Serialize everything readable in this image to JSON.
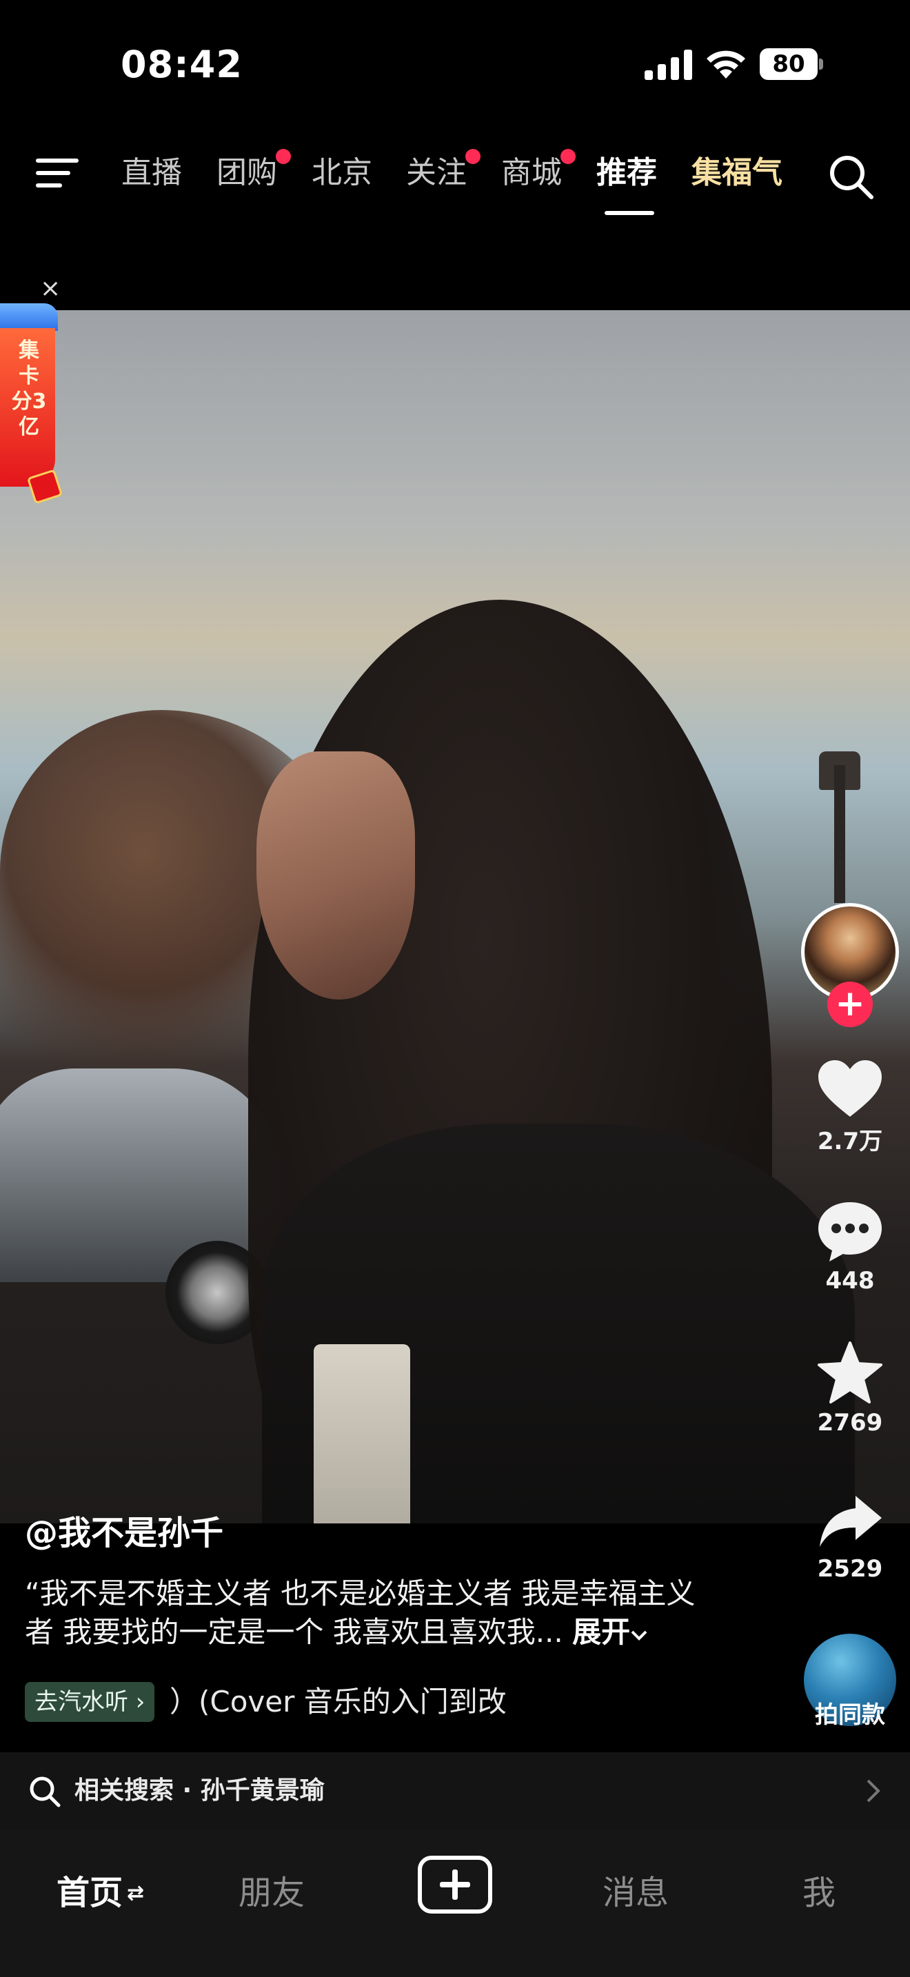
{
  "status_bar": {
    "time": "08:42",
    "battery": "80"
  },
  "top_nav": {
    "tabs": [
      {
        "label": "直播",
        "badge": false
      },
      {
        "label": "团购",
        "badge": true
      },
      {
        "label": "北京",
        "badge": false
      },
      {
        "label": "关注",
        "badge": true
      },
      {
        "label": "商城",
        "badge": true
      },
      {
        "label": "推荐",
        "badge": false,
        "active": true
      },
      {
        "label": "集福气",
        "badge": false
      }
    ]
  },
  "ad_banner": {
    "close": "×",
    "text": "集卡分3亿"
  },
  "actions": {
    "like_count": "2.7万",
    "comment_count": "448",
    "favorite_count": "2769",
    "share_count": "2529",
    "same_style_label": "拍同款"
  },
  "caption": {
    "username": "@我不是孙千",
    "description": "“我不是不婚主义者 也不是必婚主义者 我是幸福主义者 我要找的一定是一个 我喜欢且喜欢我...",
    "expand_label": "展开",
    "music_chip": "去汽水听 ›",
    "music_text": "）(Cover 音乐的入门到改"
  },
  "related_search": {
    "label": "相关搜索 · 孙千黄景瑜"
  },
  "bottom_nav": {
    "home": "首页",
    "friends": "朋友",
    "messages": "消息",
    "me": "我"
  },
  "colors": {
    "accent": "#fe2c55",
    "gold_tab": "#f7e0a3",
    "background": "#000000"
  }
}
